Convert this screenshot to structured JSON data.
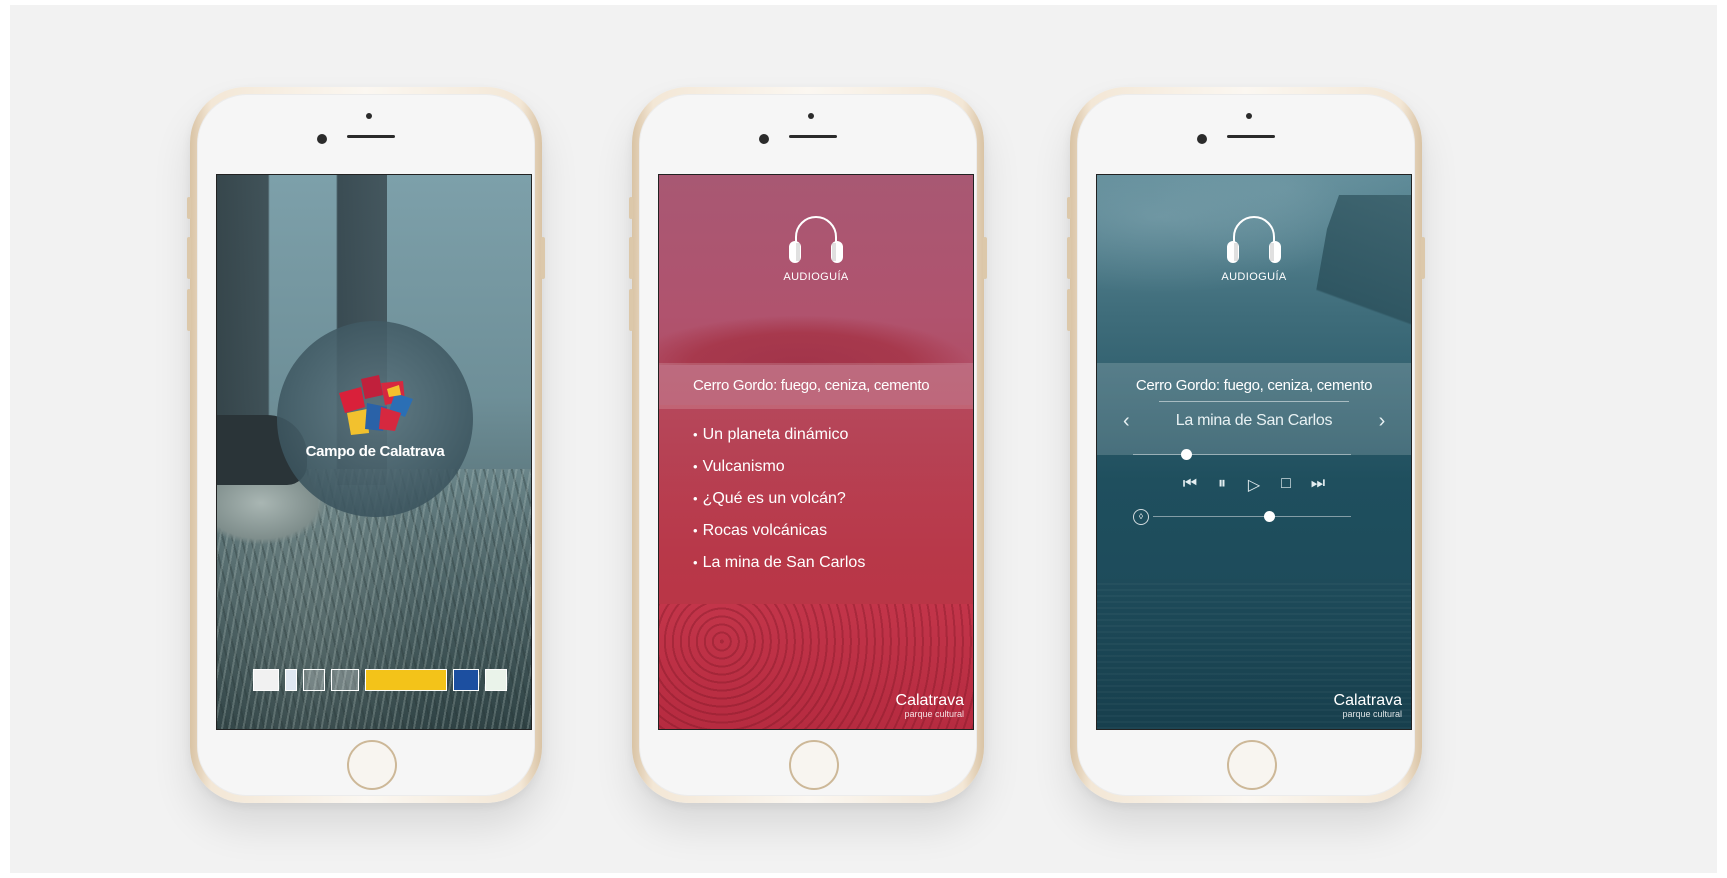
{
  "colors": {
    "background": "#f2f2f2",
    "screen2_tint": "#b24a5f",
    "screen3_tint": "#1f4f5e",
    "phone_gold": "#d9c3a4"
  },
  "screen1": {
    "logo_text": "Campo de Calatrava",
    "logo_icon": "campo-de-calatrava-logo-icon",
    "sponsor_logos": [
      "sponsor-logo-1",
      "sponsor-logo-2",
      "sponsor-logo-3",
      "sponsor-logo-4",
      "sponsor-logo-5",
      "sponsor-logo-6"
    ]
  },
  "screen2": {
    "header_icon": "headphones-icon",
    "header_label": "AUDIOGUÍA",
    "section_title": "Cerro Gordo: fuego, ceniza, cemento",
    "bullet": "•",
    "items": [
      "Un planeta dinámico",
      "Vulcanismo",
      "¿Qué es un volcán?",
      "Rocas volcánicas",
      "La mina de San Carlos"
    ],
    "brand_name": "Calatrava",
    "brand_sub": "parque cultural"
  },
  "screen3": {
    "header_icon": "headphones-icon",
    "header_label": "AUDIOGUÍA",
    "section_title": "Cerro Gordo: fuego, ceniza, cemento",
    "track_name": "La mina de San Carlos",
    "prev_glyph": "‹",
    "next_glyph": "›",
    "progress": 0.22,
    "volume": 0.56,
    "controls": {
      "rewind": "⏮",
      "pause": "⏸",
      "play": "▷",
      "stop": "□",
      "forward": "⏭"
    },
    "brand_name": "Calatrava",
    "brand_sub": "parque cultural"
  }
}
